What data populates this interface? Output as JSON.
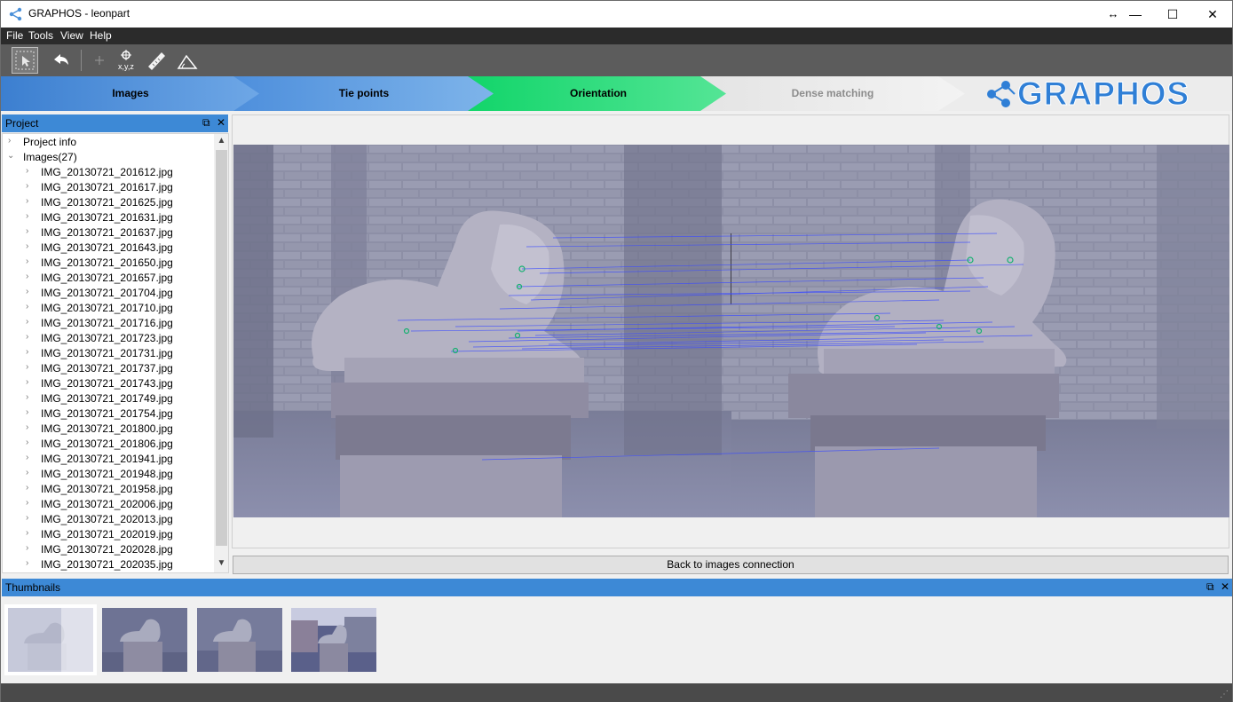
{
  "window": {
    "title": "GRAPHOS - leonpart",
    "controls": {
      "resize": "↔",
      "minimize": "—",
      "maximize": "☐",
      "close": "✕"
    }
  },
  "menu": [
    "File",
    "Tools",
    "View",
    "Help"
  ],
  "toolbar": {
    "tools": [
      "select-icon",
      "undo-icon",
      "point-icon",
      "coordinate-icon",
      "ruler-icon",
      "angle-icon"
    ],
    "coord_label": "x,y,z"
  },
  "workflow": {
    "steps": [
      {
        "label": "Images",
        "state": "done"
      },
      {
        "label": "Tie points",
        "state": "done"
      },
      {
        "label": "Orientation",
        "state": "active"
      },
      {
        "label": "Dense matching",
        "state": "pending"
      }
    ],
    "logo_text": "GRAPHOS"
  },
  "project_panel": {
    "title": "Project",
    "float_icon": "⧉",
    "close_icon": "✕",
    "project_info": "Project info",
    "images_node": "Images(27)",
    "images": [
      "IMG_20130721_201612.jpg",
      "IMG_20130721_201617.jpg",
      "IMG_20130721_201625.jpg",
      "IMG_20130721_201631.jpg",
      "IMG_20130721_201637.jpg",
      "IMG_20130721_201643.jpg",
      "IMG_20130721_201650.jpg",
      "IMG_20130721_201657.jpg",
      "IMG_20130721_201704.jpg",
      "IMG_20130721_201710.jpg",
      "IMG_20130721_201716.jpg",
      "IMG_20130721_201723.jpg",
      "IMG_20130721_201731.jpg",
      "IMG_20130721_201737.jpg",
      "IMG_20130721_201743.jpg",
      "IMG_20130721_201749.jpg",
      "IMG_20130721_201754.jpg",
      "IMG_20130721_201800.jpg",
      "IMG_20130721_201806.jpg",
      "IMG_20130721_201941.jpg",
      "IMG_20130721_201948.jpg",
      "IMG_20130721_201958.jpg",
      "IMG_20130721_202006.jpg",
      "IMG_20130721_202013.jpg",
      "IMG_20130721_202019.jpg",
      "IMG_20130721_202028.jpg",
      "IMG_20130721_202035.jpg"
    ]
  },
  "main": {
    "back_button": "Back to images connection"
  },
  "thumbnails": {
    "title": "Thumbnails",
    "float_icon": "⧉",
    "close_icon": "✕",
    "count": 4,
    "selected_index": 0
  },
  "colors": {
    "dock_header": "#3d89d6",
    "step_blue": "#4e8fdc",
    "step_green": "#12d56a",
    "step_pending": "#e8e8e8",
    "logo_blue": "#2f7fd6",
    "match_line": "#3b4bff"
  }
}
